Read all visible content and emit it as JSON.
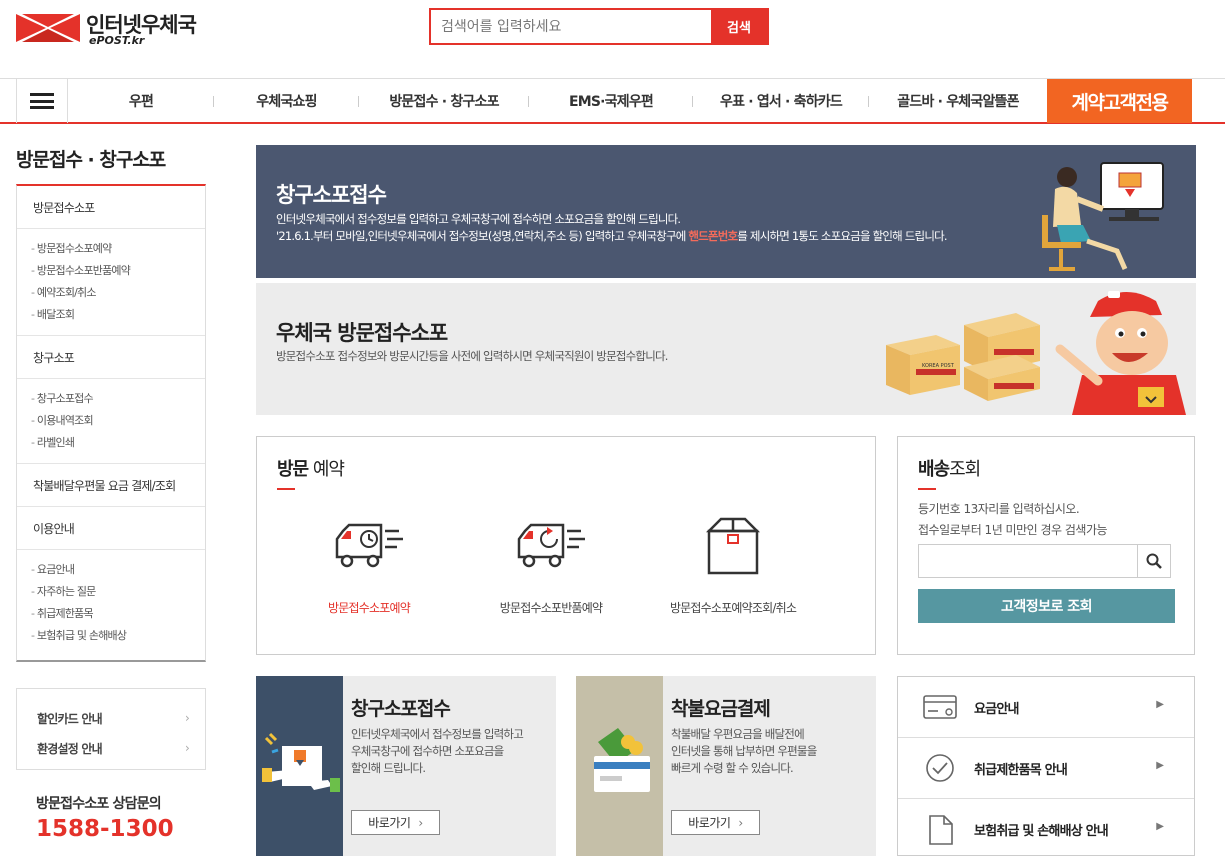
{
  "header": {
    "logo_title": "인터넷우체국",
    "logo_sub": "ePOST.kr",
    "search_placeholder": "검색어를 입력하세요",
    "search_button": "검색"
  },
  "gnb": {
    "items": [
      "우편",
      "우체국쇼핑",
      "방문접수 · 창구소포",
      "EMS·국제우편",
      "우표 · 엽서 · 축하카드",
      "골드바 · 우체국알뜰폰"
    ],
    "cta": "계약고객전용"
  },
  "sidebar": {
    "title": "방문접수 · 창구소포",
    "sections": [
      {
        "label": "방문접수소포",
        "items": [
          "방문접수소포예약",
          "방문접수소포반품예약",
          "예약조회/취소",
          "배달조회"
        ]
      },
      {
        "label": "창구소포",
        "items": [
          "창구소포접수",
          "이용내역조회",
          "라벨인쇄"
        ]
      },
      {
        "label": "착불배달우편물 요금 결제/조회",
        "items": []
      },
      {
        "label": "이용안내",
        "items": [
          "요금안내",
          "자주하는 질문",
          "취급제한품목",
          "보험취급 및 손해배상"
        ]
      }
    ],
    "extra_links": [
      "할인카드 안내",
      "환경설정 안내"
    ],
    "consult_label": "방문접수소포 상담문의",
    "consult_phone": "1588-1300"
  },
  "banners": {
    "counter": {
      "title": "창구소포접수",
      "desc_line1": "인터넷우체국에서 접수정보를 입력하고 우체국창구에 접수하면 소포요금을 할인해 드립니다.",
      "desc_line2_pre": "'21.6.1.부터 모바일,인터넷우체국에서 접수정보(성명,연락처,주소 등) 입력하고 우체국창구에 ",
      "desc_line2_hl": "핸드폰번호",
      "desc_line2_post": "를 제시하면 1통도 소포요금을 할인해 드립니다."
    },
    "visit": {
      "title": "우체국 방문접수소포",
      "desc": "방문접수소포 접수정보와 방문시간등을 사전에 입력하시면 우체국직원이 방문접수합니다.",
      "box_brand": "KOREA POST"
    }
  },
  "visit_box": {
    "title_bold": "방문",
    "title_rest": " 예약",
    "items": [
      "방문접수소포예약",
      "방문접수소포반품예약",
      "방문접수소포예약조회/취소"
    ]
  },
  "tracking": {
    "title_bold": "배송",
    "title_rest": "조회",
    "desc_line1": "등기번호 13자리를 입력하십시오.",
    "desc_line2": "접수일로부터 1년 미만인 경우 검색가능",
    "button": "고객정보로 조회"
  },
  "cards": [
    {
      "title": "창구소포접수",
      "desc": [
        "인터넷우체국에서 접수정보를 입력하고",
        "우체국창구에 접수하면 소포요금을",
        "할인해 드립니다."
      ],
      "button": "바로가기",
      "strip_color": "#3d5068"
    },
    {
      "title": "착불요금결제",
      "desc": [
        "착불배달 우편요금을 배달전에",
        "인터넷을 통해 납부하면 우편물을",
        "빠르게 수령 할 수 있습니다."
      ],
      "button": "바로가기",
      "strip_color": "#c5bfa8"
    }
  ],
  "links": [
    "요금안내",
    "취급제한품목 안내",
    "보험취급 및 손해배상 안내"
  ],
  "colors": {
    "brand_red": "#e4322a",
    "cta_orange": "#f26522",
    "teal": "#5697a1",
    "banner_navy": "#4b5770"
  }
}
